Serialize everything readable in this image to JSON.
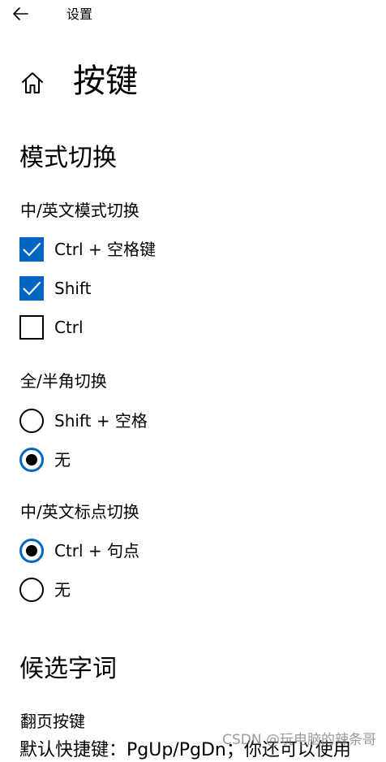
{
  "header": {
    "window_title": "设置",
    "page_title": "按键"
  },
  "mode_switch": {
    "section_title": "模式切换",
    "cn_en_toggle": {
      "label": "中/英文模式切换",
      "options": [
        {
          "label": "Ctrl + 空格键",
          "checked": true
        },
        {
          "label": "Shift",
          "checked": true
        },
        {
          "label": "Ctrl",
          "checked": false
        }
      ]
    },
    "full_half_width": {
      "label": "全/半角切换",
      "options": [
        {
          "label": "Shift + 空格",
          "selected": false
        },
        {
          "label": "无",
          "selected": true
        }
      ]
    },
    "punctuation_toggle": {
      "label": "中/英文标点切换",
      "options": [
        {
          "label": "Ctrl + 句点",
          "selected": true
        },
        {
          "label": "无",
          "selected": false
        }
      ]
    }
  },
  "candidates": {
    "section_title": "候选字词",
    "paging_label": "翻页按键",
    "partial_description": "默认快捷键：PgUp/PgDn；你还可以使用"
  },
  "watermark": "CSDN @玩电脑的辣条哥",
  "colors": {
    "accent": "#0067c0",
    "text": "#000000",
    "background": "#ffffff"
  },
  "icons": {
    "back": "back-arrow-icon",
    "home": "home-icon",
    "check": "checkmark-icon"
  }
}
